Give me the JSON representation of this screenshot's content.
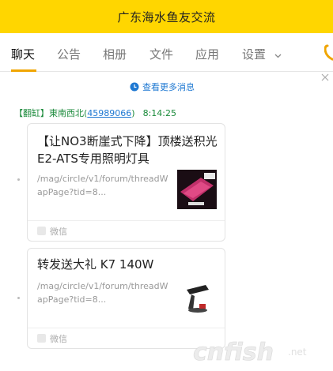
{
  "window": {
    "title": "广东海水鱼友交流"
  },
  "tabs": [
    {
      "label": "聊天"
    },
    {
      "label": "公告"
    },
    {
      "label": "相册"
    },
    {
      "label": "文件"
    },
    {
      "label": "应用"
    },
    {
      "label": "设置"
    }
  ],
  "chat": {
    "more_link": "查看更多消息",
    "sender": {
      "role": "【翻缸】",
      "name": "東南西北",
      "qq_open": "(",
      "qq": "45989066",
      "qq_close": ")",
      "time": "8:14:25"
    },
    "cards": [
      {
        "title": "【让NO3断崖式下降】顶楼送积光E2-ATS专用照明灯具",
        "url": "/mag/circle/v1/forum/threadWapPage?tid=8...",
        "source": "微信",
        "thumb_icon": "lamp-product-photo-icon"
      },
      {
        "title": "转发送大礼 K7 140W",
        "url": "/mag/circle/v1/forum/threadWapPage?tid=8...",
        "source": "微信",
        "thumb_icon": "light-fixture-photo-icon"
      }
    ]
  },
  "watermark": {
    "brand": "cnfish",
    "suffix": ".net"
  },
  "colors": {
    "titlebar": "#ffd600",
    "link": "#1e78d2",
    "sender": "#1a8a3a",
    "accent": "#f0a500"
  }
}
